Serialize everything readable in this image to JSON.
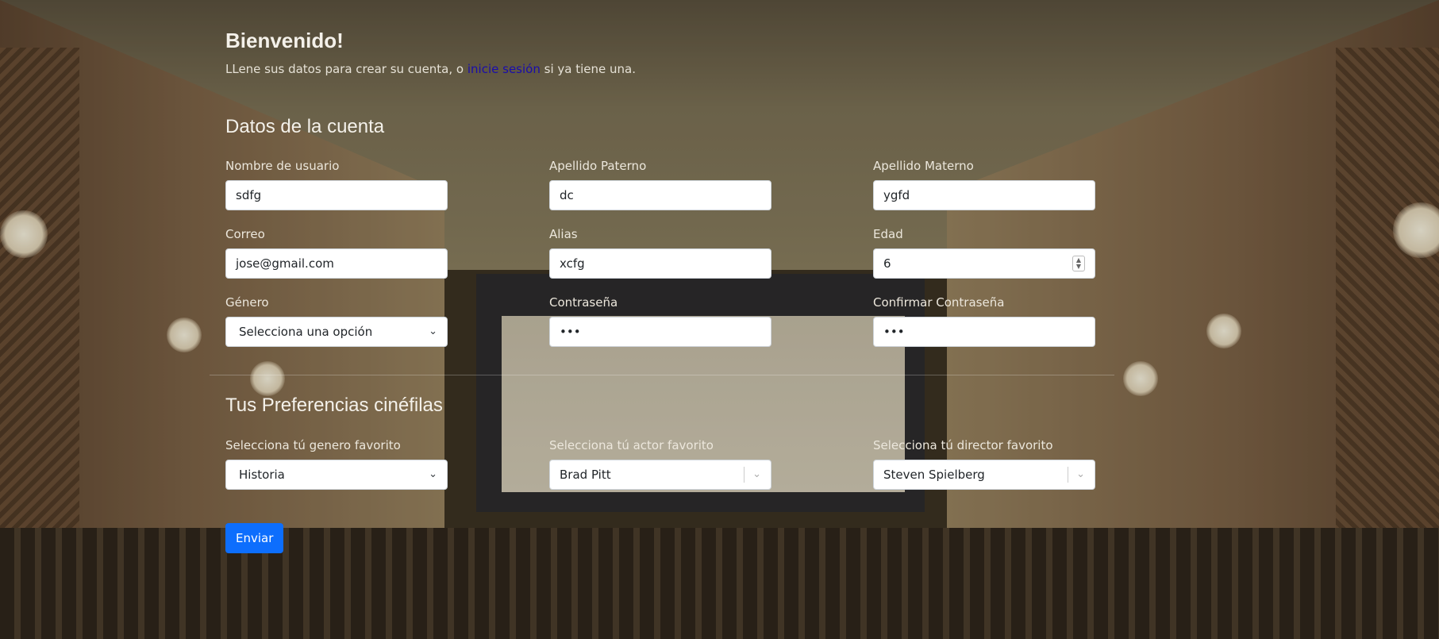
{
  "header": {
    "title": "Bienvenido!",
    "intro_prefix": "LLene sus datos para crear su cuenta, o",
    "intro_link": "inicie sesión",
    "intro_suffix": "si ya tiene una."
  },
  "account": {
    "section_title": "Datos de la cuenta",
    "username": {
      "label": "Nombre de usuario",
      "value": "sdfg"
    },
    "last_name_paternal": {
      "label": "Apellido Paterno",
      "value": "dc"
    },
    "last_name_maternal": {
      "label": "Apellido Materno",
      "value": "ygfd"
    },
    "email": {
      "label": "Correo",
      "value": "jose@gmail.com"
    },
    "alias": {
      "label": "Alias",
      "value": "xcfg"
    },
    "age": {
      "label": "Edad",
      "value": "6"
    },
    "gender": {
      "label": "Género",
      "value": "Selecciona una opción"
    },
    "password": {
      "label": "Contraseña",
      "value": "•••"
    },
    "confirm_password": {
      "label": "Confirmar Contraseña",
      "value": "•••"
    }
  },
  "preferences": {
    "section_title": "Tus Preferencias cinéfilas",
    "genre": {
      "label": "Selecciona tú genero favorito",
      "value": "Historia"
    },
    "actor": {
      "label": "Selecciona tú actor favorito",
      "value": "Brad Pitt"
    },
    "director": {
      "label": "Selecciona tú director favorito",
      "value": "Steven Spielberg"
    }
  },
  "submit_label": "Enviar",
  "icons": {
    "select": "chevron-down-icon",
    "spinner": "number-spinner-icon"
  },
  "colors": {
    "link": "#1a0dab",
    "button": "#0d6efd"
  }
}
